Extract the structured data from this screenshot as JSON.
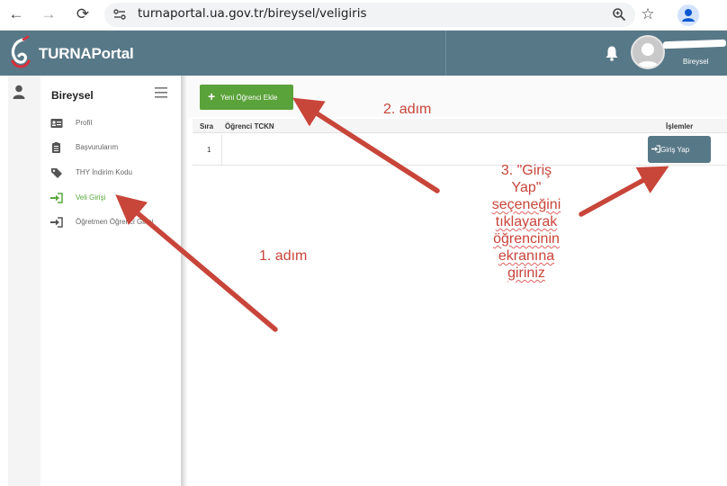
{
  "browser": {
    "url": "turnaportal.ua.gov.tr/bireysel/veligiris",
    "back_icon": "←",
    "forward_icon": "→",
    "reload_icon": "⟳",
    "zoom_icon": "⊕",
    "bookmark_icon": "☆"
  },
  "header": {
    "brand": "TURNAPortal",
    "user_role": "Bireysel",
    "colors": {
      "bar": "#577887",
      "accent": "#5aa23a"
    }
  },
  "sidebar": {
    "title": "Bireysel",
    "items": [
      {
        "label": "Profil",
        "icon": "id-card-icon"
      },
      {
        "label": "Başvurularım",
        "icon": "clipboard-icon"
      },
      {
        "label": "THY İndirim Kodu",
        "icon": "tag-icon"
      },
      {
        "label": "Veli Girişi",
        "icon": "sign-in-icon",
        "active": true
      },
      {
        "label": "Öğretmen Öğrenci Girişi",
        "icon": "sign-in-icon"
      }
    ]
  },
  "main": {
    "add_button_label": "Yeni Öğrenci Ekle",
    "table": {
      "columns": [
        "Sıra",
        "Öğrenci TCKN",
        "İşlemler"
      ],
      "rows": [
        {
          "num": "1",
          "tckn": "",
          "action": "Giriş Yap"
        }
      ]
    }
  },
  "annotations": {
    "step1": "1. adım",
    "step2": "2. adım",
    "step3_lines": [
      "3. \"Giriş",
      "Yap\"",
      "seçeneğini",
      "tıklayarak",
      "öğrencinin",
      "ekranına",
      "giriniz"
    ]
  }
}
